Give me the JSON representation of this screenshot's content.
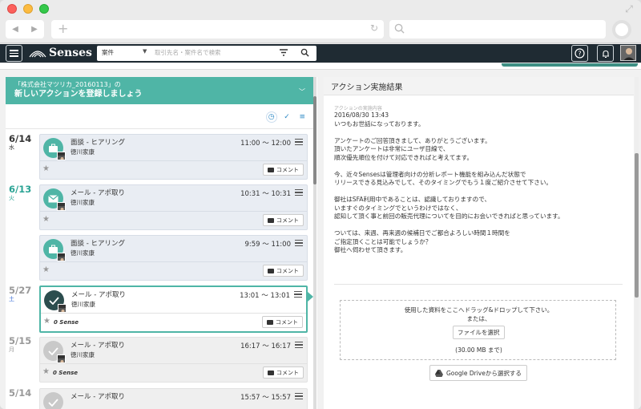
{
  "browser": {
    "url": "",
    "search": ""
  },
  "header": {
    "logo": "Senses",
    "search": {
      "category": "案件",
      "placeholder": "取引先名・案件名で検索"
    },
    "help_label": "?",
    "colors": {
      "appbar": "#1f2b33",
      "accent": "#4fb5a6"
    }
  },
  "banner": {
    "line1": "「株式会社マツリカ_20160113」の",
    "line2": "新しいアクションを登録しましょう"
  },
  "timeline": [
    {
      "date": "6/14",
      "weekday": "水",
      "state": "future",
      "cards": [
        {
          "title": "面談 - ヒアリング",
          "person": "徳川家康",
          "time": "11:00 ～ 12:00",
          "icon": "briefcase-icon",
          "sense": "",
          "comment": "コメント"
        }
      ]
    },
    {
      "date": "6/13",
      "weekday": "火",
      "state": "today",
      "cards": [
        {
          "title": "メール - アポ取り",
          "person": "徳川家康",
          "time": "10:31 ～ 10:31",
          "icon": "mail-icon",
          "sense": "",
          "comment": "コメント"
        },
        {
          "title": "面談 - ヒアリング",
          "person": "徳川家康",
          "time": "9:59 ～ 11:00",
          "icon": "briefcase-icon",
          "sense": "",
          "comment": "コメント"
        }
      ]
    },
    {
      "date": "5/27",
      "weekday": "土",
      "state": "past",
      "cards": [
        {
          "title": "メール - アポ取り",
          "person": "徳川家康",
          "time": "13:01 ～ 13:01",
          "icon": "check-icon",
          "sense": "0 Sense",
          "comment": "コメント",
          "selected": true
        }
      ]
    },
    {
      "date": "5/15",
      "weekday": "月",
      "state": "past",
      "cards": [
        {
          "title": "メール - アポ取り",
          "person": "徳川家康",
          "time": "16:17 ～ 16:17",
          "icon": "check-icon",
          "sense": "0 Sense",
          "comment": "コメント"
        }
      ]
    },
    {
      "date": "5/14",
      "weekday": "",
      "state": "past",
      "cards": [
        {
          "title": "メール - アポ取り",
          "person": "",
          "time": "15:57 ～ 15:57",
          "icon": "check-icon",
          "sense": "",
          "comment": ""
        }
      ]
    }
  ],
  "detail": {
    "header": "アクション実施結果",
    "small_label": "アクションの実施内容",
    "message": "2016/08/30 13:43\nいつもお世話になっております。\n\nアンケートのご回答頂きまして、ありがとうございます。\n頂いたアンケートは非常にユーザ目線で、\n順次優先順位を付けて対応できればと考えてます。\n\n今、近々Sensesは管理者向けの分析レポート機能を組み込んだ状態で\nリリースできる見込みでして、そのタイミングでもう１度ご紹介させて下さい。\n\n御社はSFA利用中であることは、認識しておりますので、\nいますぐのタイミングでというわけではなく、\n認知して頂く事と前回の販売代理についてを目的にお会いできればと思っています。\n\nついては、来週、再来週の候補日でご都合よろしい時間１時間を\nご指定頂くことは可能でしょうか？\n御社へ伺わせて頂きます。",
    "dropzone": {
      "line1": "使用した資料をここへドラッグ&ドロップして下さい。",
      "line2": "または、",
      "button": "ファイルを選択",
      "limit": "(30.00 MB まで)"
    },
    "gdrive_button": "Google Driveから選択する"
  }
}
